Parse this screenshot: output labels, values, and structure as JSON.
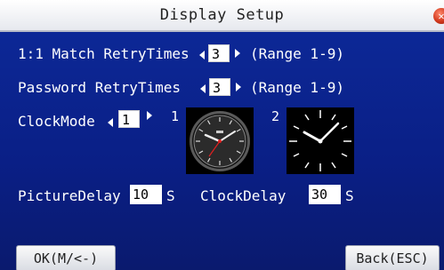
{
  "title": "Display Setup",
  "close_icon": "close-icon",
  "rows": {
    "match_retry": {
      "label": "1:1 Match RetryTimes",
      "value": "3",
      "range": "(Range 1-9)"
    },
    "password_retry": {
      "label": "Password RetryTimes",
      "value": "3",
      "range": "(Range 1-9)"
    },
    "clock_mode": {
      "label": "ClockMode",
      "value": "1",
      "option1": "1",
      "option2": "2"
    },
    "picture_delay": {
      "label": "PictureDelay",
      "value": "10",
      "unit": "S"
    },
    "clock_delay": {
      "label": "ClockDelay",
      "value": "30",
      "unit": "S"
    }
  },
  "buttons": {
    "ok": "OK(M/<-)",
    "back": "Back(ESC)"
  },
  "colors": {
    "background": "#0a1f86",
    "titlebar": "#ffffff",
    "close": "#d2381c"
  }
}
